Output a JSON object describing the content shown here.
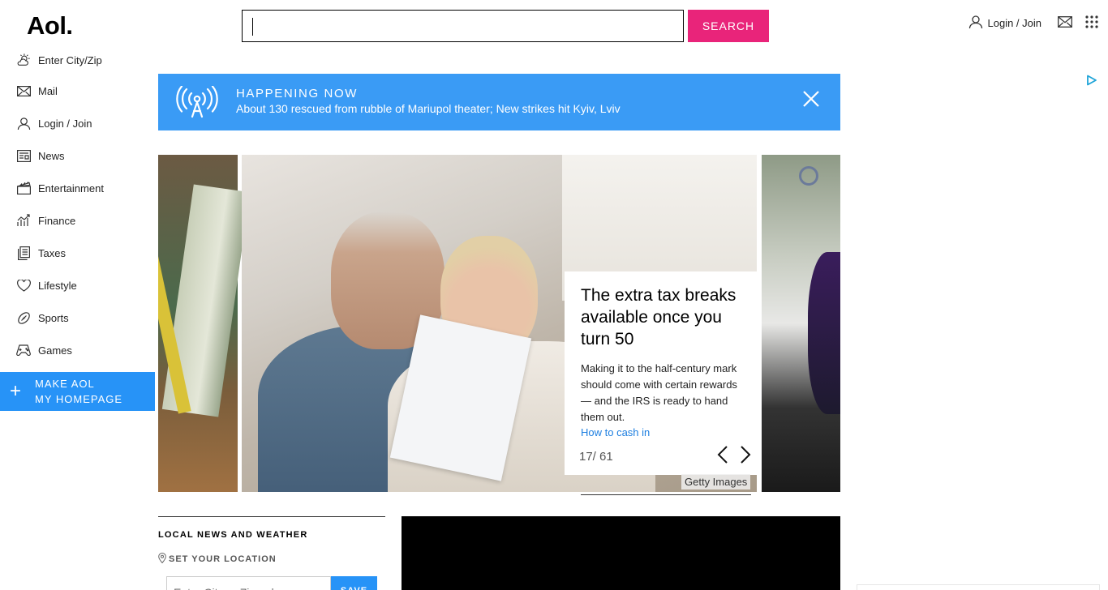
{
  "header": {
    "logo": "Aol.",
    "search_value": "",
    "search_button": "SEARCH",
    "login_label": "Login / Join"
  },
  "sidebar": {
    "items": [
      {
        "label": "Enter City/Zip",
        "icon": "weather-icon"
      },
      {
        "label": "Mail",
        "icon": "mail-icon"
      },
      {
        "label": "Login / Join",
        "icon": "user-icon"
      },
      {
        "label": "News",
        "icon": "news-icon"
      },
      {
        "label": "Entertainment",
        "icon": "clapperboard-icon"
      },
      {
        "label": "Finance",
        "icon": "finance-icon"
      },
      {
        "label": "Taxes",
        "icon": "taxes-icon"
      },
      {
        "label": "Lifestyle",
        "icon": "heart-icon"
      },
      {
        "label": "Sports",
        "icon": "football-icon"
      },
      {
        "label": "Games",
        "icon": "gamepad-icon"
      }
    ],
    "make_home_line1": "MAKE AOL",
    "make_home_line2": "MY HOMEPAGE"
  },
  "banner": {
    "title": "HAPPENING NOW",
    "text": "About 130 rescued from rubble of Mariupol theater; New strikes hit Kyiv, Lviv",
    "color": "#3a9bf5"
  },
  "slideshow": {
    "headline": "The extra tax breaks available once you turn 50",
    "summary": "Making it to the half-century mark should come with certain rewards — and the IRS is ready to hand them out.",
    "cta": "How to cash in",
    "counter": "17/ 61",
    "credit": "Getty Images"
  },
  "local": {
    "title": "LOCAL NEWS AND WEATHER",
    "set_location": "SET YOUR LOCATION",
    "zip_placeholder": "Enter City or Zipcode",
    "save_label": "SAVE"
  },
  "colors": {
    "accent_pink": "#e9247a",
    "accent_blue": "#2793f7",
    "link_blue": "#1e7fe0"
  }
}
